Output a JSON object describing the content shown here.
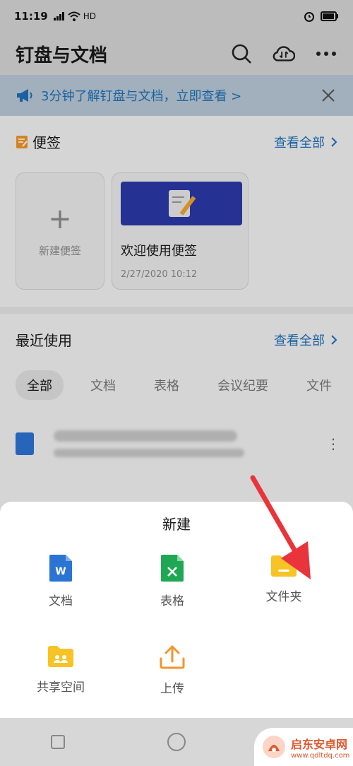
{
  "status_bar": {
    "time": "11:19",
    "network": "HD"
  },
  "header": {
    "title": "钉盘与文档"
  },
  "banner": {
    "text": "3分钟了解钉盘与文档，立即查看 >"
  },
  "notes": {
    "title": "便签",
    "see_all": "查看全部",
    "new_label": "新建便签",
    "welcome_title": "欢迎使用便签",
    "welcome_date": "2/27/2020 10:12"
  },
  "recent": {
    "title": "最近使用",
    "see_all": "查看全部",
    "filters": [
      "全部",
      "文档",
      "表格",
      "会议纪要",
      "文件"
    ],
    "active_filter": 0
  },
  "sheet": {
    "title": "新建",
    "items": [
      {
        "label": "文档",
        "icon": "doc-icon",
        "color": "#2c74d4"
      },
      {
        "label": "表格",
        "icon": "sheet-icon",
        "color": "#1fa854"
      },
      {
        "label": "文件夹",
        "icon": "folder-icon",
        "color": "#f7c325"
      },
      {
        "label": "共享空间",
        "icon": "shared-folder-icon",
        "color": "#f7c325"
      },
      {
        "label": "上传",
        "icon": "upload-icon",
        "color": "#f0962a"
      }
    ]
  },
  "watermark": {
    "name": "启东安卓网",
    "url": "www.qdltdq.com"
  },
  "colors": {
    "accent": "#1f6fb8",
    "annotation_arrow": "#e8343a"
  }
}
